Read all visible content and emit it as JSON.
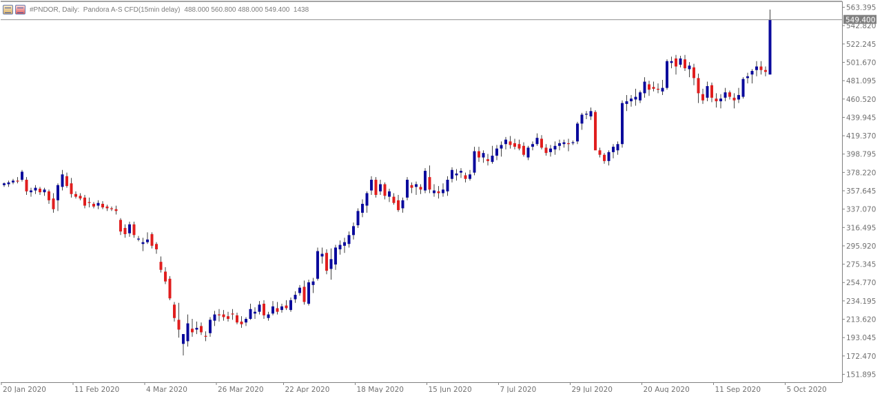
{
  "header": {
    "symbol_line": "#PNDOR, Daily:  Pandora A-S CFD(15min delay)",
    "ohlc_line": "488.000 560.800 488.000 549.400  1438",
    "icons": [
      "chart-properties-icon",
      "symbol-icon"
    ]
  },
  "colors": {
    "bull": "#0a0a9c",
    "bear": "#e01e1e",
    "axis": "#7f7f7f",
    "text": "#707070",
    "price_label_bg": "#808080"
  },
  "chart_data": {
    "type": "candlestick",
    "title": "#PNDOR, Daily:  Pandora A-S CFD(15min delay)",
    "y_ticks": [
      "563.395",
      "542.820",
      "522.245",
      "501.670",
      "481.095",
      "460.520",
      "439.945",
      "419.370",
      "398.795",
      "378.220",
      "357.645",
      "337.070",
      "316.495",
      "295.920",
      "275.345",
      "254.770",
      "234.195",
      "213.620",
      "193.045",
      "172.470",
      "151.895"
    ],
    "ylim": [
      143.0,
      570.0
    ],
    "x_tick_labels": [
      {
        "index": 0,
        "label": "20 Jan 2020"
      },
      {
        "index": 16,
        "label": "11 Feb 2020"
      },
      {
        "index": 32,
        "label": "4 Mar 2020"
      },
      {
        "index": 48,
        "label": "26 Mar 2020"
      },
      {
        "index": 63,
        "label": "22 Apr 2020"
      },
      {
        "index": 79,
        "label": "18 May 2020"
      },
      {
        "index": 95,
        "label": "15 Jun 2020"
      },
      {
        "index": 111,
        "label": "7 Jul 2020"
      },
      {
        "index": 127,
        "label": "29 Jul 2020"
      },
      {
        "index": 143,
        "label": "20 Aug 2020"
      },
      {
        "index": 159,
        "label": "11 Sep 2020"
      },
      {
        "index": 175,
        "label": "5 Oct 2020"
      }
    ],
    "last_price": "549.400",
    "grid": false,
    "candles": [
      [
        364,
        367,
        362,
        366
      ],
      [
        365,
        369,
        362,
        367
      ],
      [
        367,
        371,
        365,
        369
      ],
      [
        369,
        373,
        366,
        368
      ],
      [
        370,
        381,
        368,
        379
      ],
      [
        370,
        373,
        353,
        357
      ],
      [
        356,
        361,
        351,
        358
      ],
      [
        358,
        364,
        354,
        361
      ],
      [
        360,
        362,
        353,
        356
      ],
      [
        356,
        361,
        352,
        359
      ],
      [
        357,
        359,
        343,
        347
      ],
      [
        349,
        355,
        333,
        337
      ],
      [
        347,
        366,
        335,
        364
      ],
      [
        362,
        381,
        358,
        376
      ],
      [
        374,
        378,
        361,
        363
      ],
      [
        366,
        372,
        350,
        354
      ],
      [
        354,
        357,
        349,
        351
      ],
      [
        352,
        355,
        347,
        349
      ],
      [
        350,
        353,
        338,
        341
      ],
      [
        345,
        350,
        339,
        344
      ],
      [
        343,
        345,
        338,
        340
      ],
      [
        341,
        347,
        337,
        344
      ],
      [
        343,
        346,
        337,
        339
      ],
      [
        340,
        342,
        335,
        338
      ],
      [
        338,
        340,
        335,
        337
      ],
      [
        337,
        341,
        331,
        335
      ],
      [
        325,
        327,
        308,
        312
      ],
      [
        316,
        320,
        305,
        309
      ],
      [
        310,
        323,
        306,
        320
      ],
      [
        320,
        323,
        305,
        308
      ],
      [
        303,
        307,
        301,
        304
      ],
      [
        298,
        305,
        290,
        300
      ],
      [
        300,
        311,
        298,
        303
      ],
      [
        309,
        311,
        293,
        296
      ],
      [
        298,
        300,
        287,
        292
      ],
      [
        278,
        284,
        266,
        269
      ],
      [
        267,
        272,
        253,
        256
      ],
      [
        259,
        262,
        235,
        237
      ],
      [
        230,
        233,
        211,
        215
      ],
      [
        213,
        232,
        193,
        202
      ],
      [
        186,
        197,
        173,
        197
      ],
      [
        189,
        219,
        183,
        209
      ],
      [
        203,
        214,
        194,
        199
      ],
      [
        202,
        211,
        197,
        204
      ],
      [
        206,
        210,
        196,
        199
      ],
      [
        195,
        200,
        189,
        194
      ],
      [
        198,
        216,
        194,
        213
      ],
      [
        212,
        223,
        206,
        219
      ],
      [
        219,
        225,
        211,
        218
      ],
      [
        219,
        224,
        212,
        216
      ],
      [
        217,
        222,
        211,
        214
      ],
      [
        220,
        225,
        213,
        219
      ],
      [
        218,
        221,
        208,
        210
      ],
      [
        211,
        217,
        204,
        208
      ],
      [
        210,
        216,
        206,
        214
      ],
      [
        214,
        231,
        213,
        225
      ],
      [
        220,
        227,
        214,
        222
      ],
      [
        222,
        234,
        219,
        230
      ],
      [
        231,
        235,
        214,
        218
      ],
      [
        215,
        222,
        212,
        219
      ],
      [
        220,
        234,
        218,
        228
      ],
      [
        226,
        233,
        219,
        222
      ],
      [
        224,
        231,
        221,
        228
      ],
      [
        229,
        235,
        224,
        226
      ],
      [
        224,
        238,
        222,
        235
      ],
      [
        236,
        245,
        232,
        241
      ],
      [
        243,
        252,
        240,
        249
      ],
      [
        250,
        257,
        230,
        233
      ],
      [
        231,
        258,
        229,
        255
      ],
      [
        252,
        260,
        243,
        256
      ],
      [
        259,
        294,
        257,
        290
      ],
      [
        284,
        294,
        276,
        287
      ],
      [
        288,
        292,
        264,
        268
      ],
      [
        270,
        293,
        258,
        281
      ],
      [
        275,
        297,
        269,
        294
      ],
      [
        292,
        302,
        286,
        297
      ],
      [
        296,
        305,
        288,
        300
      ],
      [
        298,
        312,
        294,
        308
      ],
      [
        308,
        322,
        303,
        318
      ],
      [
        319,
        338,
        316,
        335
      ],
      [
        333,
        348,
        328,
        343
      ],
      [
        341,
        357,
        333,
        355
      ],
      [
        358,
        374,
        353,
        370
      ],
      [
        370,
        373,
        350,
        353
      ],
      [
        357,
        370,
        353,
        365
      ],
      [
        365,
        367,
        348,
        352
      ],
      [
        351,
        360,
        345,
        357
      ],
      [
        351,
        355,
        342,
        344
      ],
      [
        347,
        353,
        334,
        336
      ],
      [
        338,
        350,
        333,
        347
      ],
      [
        350,
        373,
        347,
        370
      ],
      [
        364,
        367,
        355,
        361
      ],
      [
        362,
        368,
        353,
        365
      ],
      [
        362,
        365,
        354,
        359
      ],
      [
        358,
        383,
        355,
        380
      ],
      [
        373,
        386,
        355,
        359
      ],
      [
        355,
        365,
        351,
        358
      ],
      [
        357,
        363,
        349,
        355
      ],
      [
        355,
        366,
        351,
        359
      ],
      [
        357,
        374,
        352,
        370
      ],
      [
        371,
        384,
        367,
        381
      ],
      [
        375,
        382,
        369,
        377
      ],
      [
        378,
        383,
        372,
        380
      ],
      [
        375,
        378,
        367,
        371
      ],
      [
        371,
        381,
        369,
        376
      ],
      [
        378,
        407,
        375,
        402
      ],
      [
        402,
        407,
        390,
        395
      ],
      [
        395,
        403,
        389,
        400
      ],
      [
        393,
        399,
        386,
        391
      ],
      [
        390,
        408,
        388,
        397
      ],
      [
        397,
        409,
        392,
        405
      ],
      [
        405,
        413,
        396,
        409
      ],
      [
        410,
        418,
        404,
        415
      ],
      [
        413,
        419,
        405,
        409
      ],
      [
        411,
        416,
        404,
        407
      ],
      [
        410,
        415,
        403,
        405
      ],
      [
        408,
        412,
        396,
        398
      ],
      [
        395,
        408,
        392,
        406
      ],
      [
        407,
        413,
        403,
        410
      ],
      [
        410,
        422,
        408,
        417
      ],
      [
        416,
        420,
        404,
        406
      ],
      [
        406,
        410,
        397,
        400
      ],
      [
        401,
        409,
        396,
        405
      ],
      [
        404,
        413,
        398,
        408
      ],
      [
        408,
        415,
        403,
        411
      ],
      [
        410,
        415,
        406,
        412
      ],
      [
        411,
        416,
        402,
        410
      ],
      [
        411,
        414,
        409,
        412
      ],
      [
        413,
        435,
        410,
        433
      ],
      [
        433,
        445,
        426,
        443
      ],
      [
        443,
        447,
        438,
        444
      ],
      [
        441,
        451,
        437,
        447
      ],
      [
        446,
        448,
        420,
        403
      ],
      [
        403,
        406,
        395,
        398
      ],
      [
        398,
        400,
        388,
        391
      ],
      [
        391,
        403,
        386,
        401
      ],
      [
        401,
        410,
        394,
        407
      ],
      [
        403,
        413,
        398,
        410
      ],
      [
        410,
        459,
        406,
        456
      ],
      [
        455,
        465,
        447,
        458
      ],
      [
        458,
        465,
        452,
        461
      ],
      [
        460,
        472,
        453,
        463
      ],
      [
        459,
        470,
        456,
        468
      ],
      [
        467,
        485,
        462,
        480
      ],
      [
        477,
        481,
        464,
        471
      ],
      [
        474,
        480,
        469,
        472
      ],
      [
        472,
        478,
        467,
        471
      ],
      [
        469,
        482,
        465,
        473
      ],
      [
        473,
        505,
        471,
        503
      ],
      [
        501,
        508,
        495,
        503
      ],
      [
        506,
        510,
        488,
        497
      ],
      [
        499,
        509,
        496,
        506
      ],
      [
        505,
        510,
        492,
        495
      ],
      [
        494,
        502,
        485,
        498
      ],
      [
        496,
        500,
        476,
        484
      ],
      [
        484,
        489,
        456,
        467
      ],
      [
        466,
        472,
        455,
        459
      ],
      [
        462,
        480,
        458,
        475
      ],
      [
        476,
        479,
        457,
        462
      ],
      [
        461,
        467,
        451,
        458
      ],
      [
        458,
        466,
        450,
        461
      ],
      [
        462,
        473,
        458,
        468
      ],
      [
        468,
        470,
        460,
        463
      ],
      [
        462,
        467,
        450,
        459
      ],
      [
        460,
        473,
        456,
        465
      ],
      [
        463,
        485,
        461,
        483
      ],
      [
        484,
        490,
        478,
        486
      ],
      [
        488,
        494,
        478,
        492
      ],
      [
        493,
        503,
        486,
        497
      ],
      [
        497,
        503,
        488,
        493
      ],
      [
        493,
        497,
        486,
        491
      ],
      [
        488,
        560.8,
        488,
        549.4
      ]
    ]
  }
}
